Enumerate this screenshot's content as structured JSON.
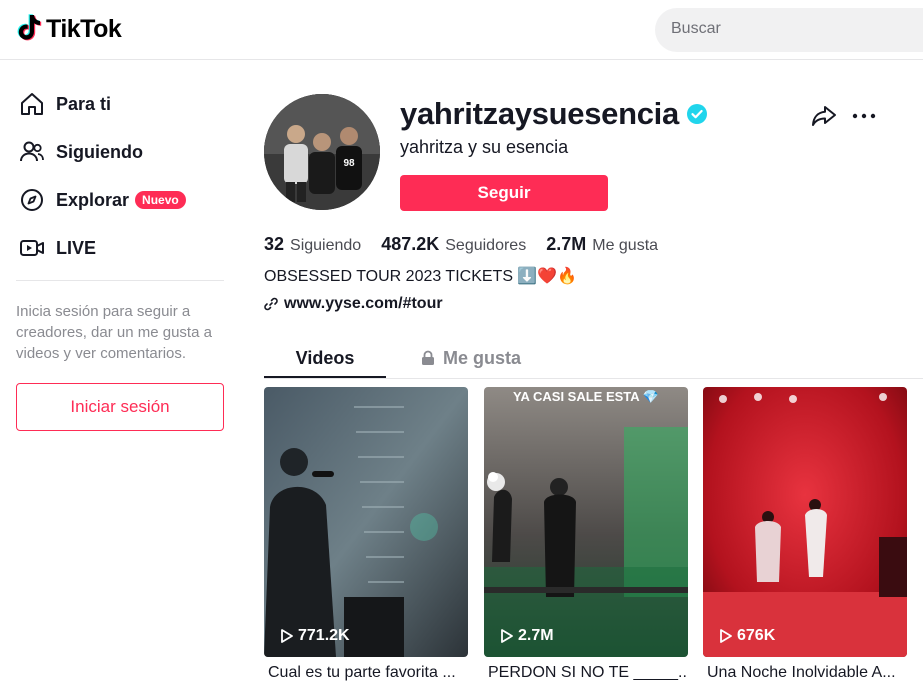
{
  "header": {
    "logo_text": "TikTok",
    "search_placeholder": "Buscar"
  },
  "sidebar": {
    "items": [
      {
        "label": "Para ti",
        "icon": "home-icon"
      },
      {
        "label": "Siguiendo",
        "icon": "users-icon"
      },
      {
        "label": "Explorar",
        "icon": "compass-icon",
        "badge": "Nuevo"
      },
      {
        "label": "LIVE",
        "icon": "live-icon"
      }
    ],
    "login_hint": "Inicia sesión para seguir a creadores, dar un me gusta a videos y ver comentarios.",
    "login_button": "Iniciar sesión"
  },
  "profile": {
    "username": "yahritzaysuesencia",
    "display_name": "yahritza y su esencia",
    "follow_button": "Seguir",
    "stats": {
      "following_count": "32",
      "following_label": "Siguiendo",
      "followers_count": "487.2K",
      "followers_label": "Seguidores",
      "likes_count": "2.7M",
      "likes_label": "Me gusta"
    },
    "bio": "OBSESSED TOUR 2023 TICKETS ⬇️❤️🔥",
    "link": "www.yyse.com/#tour"
  },
  "tabs": [
    {
      "label": "Videos",
      "active": true
    },
    {
      "label": "Me gusta",
      "active": false,
      "locked": true
    }
  ],
  "videos": [
    {
      "views": "771.2K",
      "caption": "Cual es tu parte favorita ...",
      "overlay": ""
    },
    {
      "views": "2.7M",
      "caption": "PERDON SI NO TE _____...",
      "overlay": "YA CASI SALE ESTA 💎"
    },
    {
      "views": "676K",
      "caption": "Una Noche Inolvidable A...",
      "overlay": ""
    }
  ],
  "colors": {
    "brand": "#fe2c55",
    "verified": "#20d5ec",
    "text": "#161823",
    "muted": "#8a8b91"
  }
}
